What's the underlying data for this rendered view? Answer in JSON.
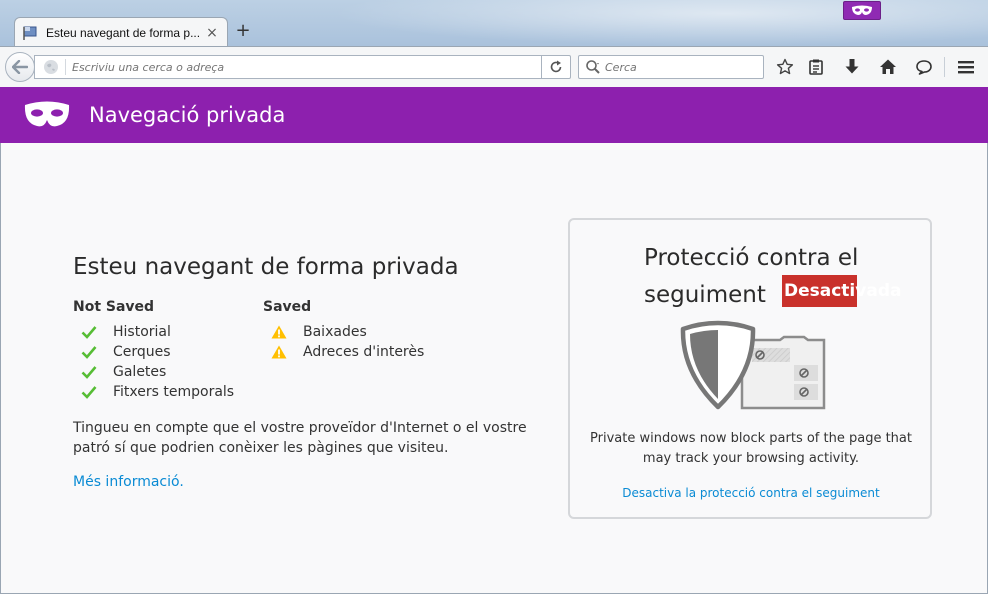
{
  "tab": {
    "title": "Esteu navegant de forma p...",
    "close": "×"
  },
  "new_tab": "+",
  "urlbar": {
    "placeholder": "Escriviu una cerca o adreça",
    "value": ""
  },
  "searchbar": {
    "placeholder": "Cerca",
    "value": ""
  },
  "header": {
    "title": "Navegació privada"
  },
  "main": {
    "title": "Esteu navegant de forma privada",
    "not_saved": {
      "heading": "Not Saved",
      "items": [
        "Historial",
        "Cerques",
        "Galetes",
        "Fitxers temporals"
      ]
    },
    "saved": {
      "heading": "Saved",
      "items": [
        "Baixades",
        "Adreces d'interès"
      ]
    },
    "note": "Tingueu en compte que el vostre proveïdor d'Internet o el vostre patró sí que podrien conèixer les pàgines que visiteu.",
    "more_link": "Més informació."
  },
  "tracking": {
    "title": "Protecció contra el seguiment",
    "status": "Desactivada",
    "description": "Private windows now block parts of the page that may track your browsing activity.",
    "toggle_link": "Desactiva la protecció contra el seguiment"
  },
  "colors": {
    "private_purple": "#8d20ae",
    "status_red": "#c9312b",
    "link_blue": "#0a8bd4",
    "check_green": "#57bd35",
    "warning_yellow": "#ffbf00"
  },
  "icons": {
    "toolbar": [
      "bookmark-star-icon",
      "reading-list-icon",
      "downloads-icon",
      "home-icon",
      "chat-icon",
      "menu-icon"
    ]
  }
}
